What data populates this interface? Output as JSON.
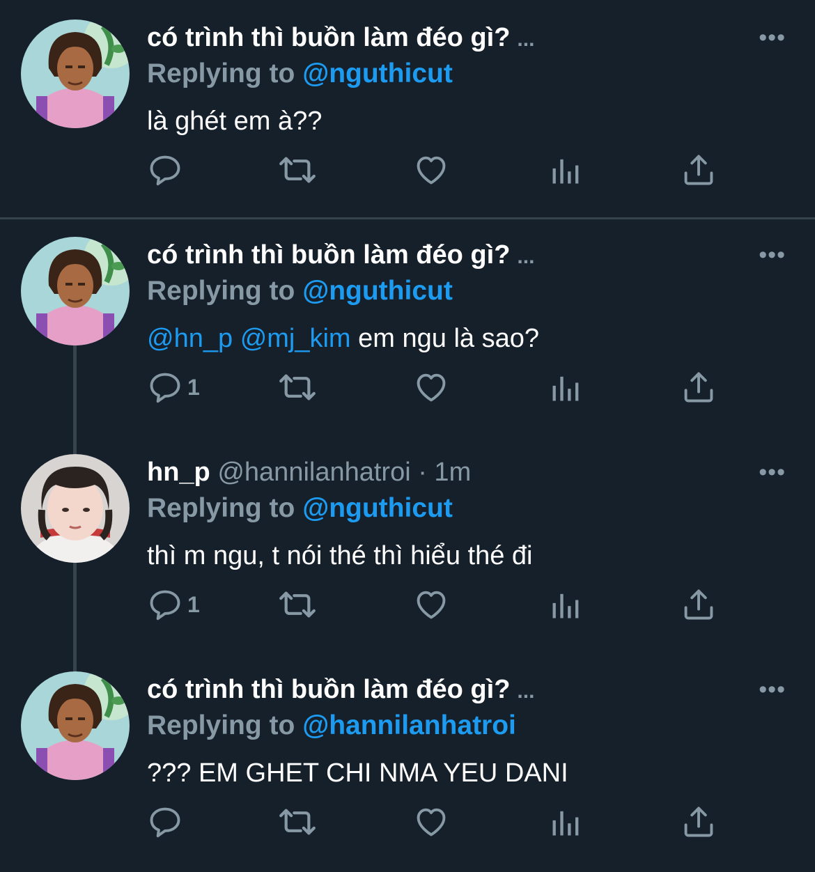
{
  "colors": {
    "background": "#15202b",
    "text": "#ffffff",
    "muted": "#8899a6",
    "link": "#1d9bf0",
    "divider": "#38444d"
  },
  "icons": {
    "reply": "reply-icon",
    "retweet": "retweet-icon",
    "like": "heart-icon",
    "analytics": "analytics-icon",
    "share": "share-icon",
    "more": "more-icon"
  },
  "tweets": [
    {
      "name": "có trình thì buồn làm đéo gì?",
      "name_trunc": "...",
      "replying_label": "Replying to",
      "replying_to": "@nguthicut",
      "body": "là ghét em à??",
      "reply_count": ""
    },
    {
      "name": "có trình thì buồn làm đéo gì?",
      "name_trunc": "...",
      "replying_label": "Replying to",
      "replying_to": "@nguthicut",
      "mention1": "@hn_p",
      "mention2": "@mj_kim",
      "body": "em ngu là sao?",
      "reply_count": "1"
    },
    {
      "name": "hn_p",
      "handle_time": "@hannilanhatroi · 1m",
      "replying_label": "Replying to",
      "replying_to": "@nguthicut",
      "body": "thì m ngu, t nói thé thì hiểu thé đi",
      "reply_count": "1"
    },
    {
      "name": "có trình thì buồn làm đéo gì?",
      "name_trunc": "...",
      "replying_label": "Replying to",
      "replying_to": "@hannilanhatroi",
      "body": "??? EM GHET CHI NMA YEU DANI",
      "reply_count": ""
    }
  ]
}
